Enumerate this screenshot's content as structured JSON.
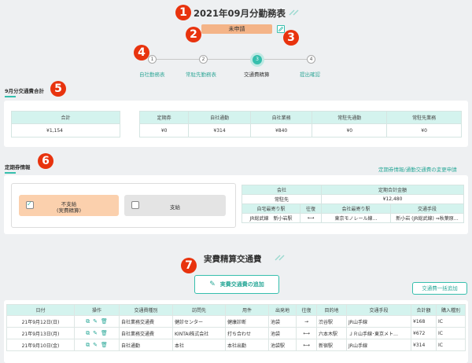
{
  "markers": [
    "1",
    "2",
    "3",
    "4",
    "5",
    "6",
    "7"
  ],
  "page_title": "2021年09月分勤務表",
  "status": "未申請",
  "steps": [
    {
      "num": "1",
      "label": "自社勤務表"
    },
    {
      "num": "2",
      "label": "常駐先勤務表"
    },
    {
      "num": "3",
      "label": "交通費精算"
    },
    {
      "num": "4",
      "label": "提出確認"
    }
  ],
  "commute_total": {
    "section_label": "9月分交通費合計",
    "total_header": "合計",
    "total_value": "¥1,154",
    "headers": [
      "定期券",
      "自社通勤",
      "自社業務",
      "常駐先通勤",
      "常駐先業務"
    ],
    "values": [
      "¥0",
      "¥314",
      "¥840",
      "¥0",
      "¥0"
    ]
  },
  "pass_info": {
    "section_label": "定期券情報",
    "change_link": "定期券情報/通勤交通費の変更申請",
    "option_unpaid_line1": "不支給",
    "option_unpaid_line2": "(実費精算)",
    "option_paid": "支給",
    "company_header": "会社",
    "company_value": "常駐先",
    "total_header": "定期合計金額",
    "total_value": "¥12,480",
    "route_headers": [
      "自宅最寄り駅",
      "往復",
      "会社最寄り駅",
      "交通手段"
    ],
    "route_values": [
      "JR総武線　新小岩駅",
      "⟷",
      "東京モノレール線…",
      "新小岩 (JR総武線) ⇒秋葉原…"
    ]
  },
  "expenses": {
    "title": "実費精算交通費",
    "add_button": "実費交通費の追加",
    "bulk_button": "交通費一括追加",
    "headers": [
      "日付",
      "操作",
      "交通費種別",
      "訪問先",
      "用件",
      "出発地",
      "往復",
      "目的地",
      "交通手段",
      "合計額",
      "購入種別"
    ],
    "rows": [
      [
        "21年9月12日(日)",
        "自社業務交通費",
        "健診センター",
        "健康診断",
        "池袋",
        "→",
        "渋谷駅",
        "JR山手線",
        "¥168",
        "IC"
      ],
      [
        "21年9月13日(月)",
        "自社業務交通費",
        "KINTAI株式会社",
        "打ち合わせ",
        "池袋",
        "⟷",
        "六本木駅",
        "ＪＲ山手線･東京メト…",
        "¥672",
        "IC"
      ],
      [
        "21年9月10日(金)",
        "自社通勤",
        "本社",
        "本社出勤",
        "池袋駅",
        "⟷",
        "新宿駅",
        "JR山手線",
        "¥314",
        "IC"
      ]
    ]
  },
  "colors": {
    "accent": "#36bfad",
    "marker": "#e8330e",
    "status": "#f4b488",
    "unpaid": "#fbd0ad"
  },
  "icons": [
    "edit-icon",
    "copy-icon",
    "pencil-icon",
    "trash-icon",
    "checkbox-icon"
  ]
}
